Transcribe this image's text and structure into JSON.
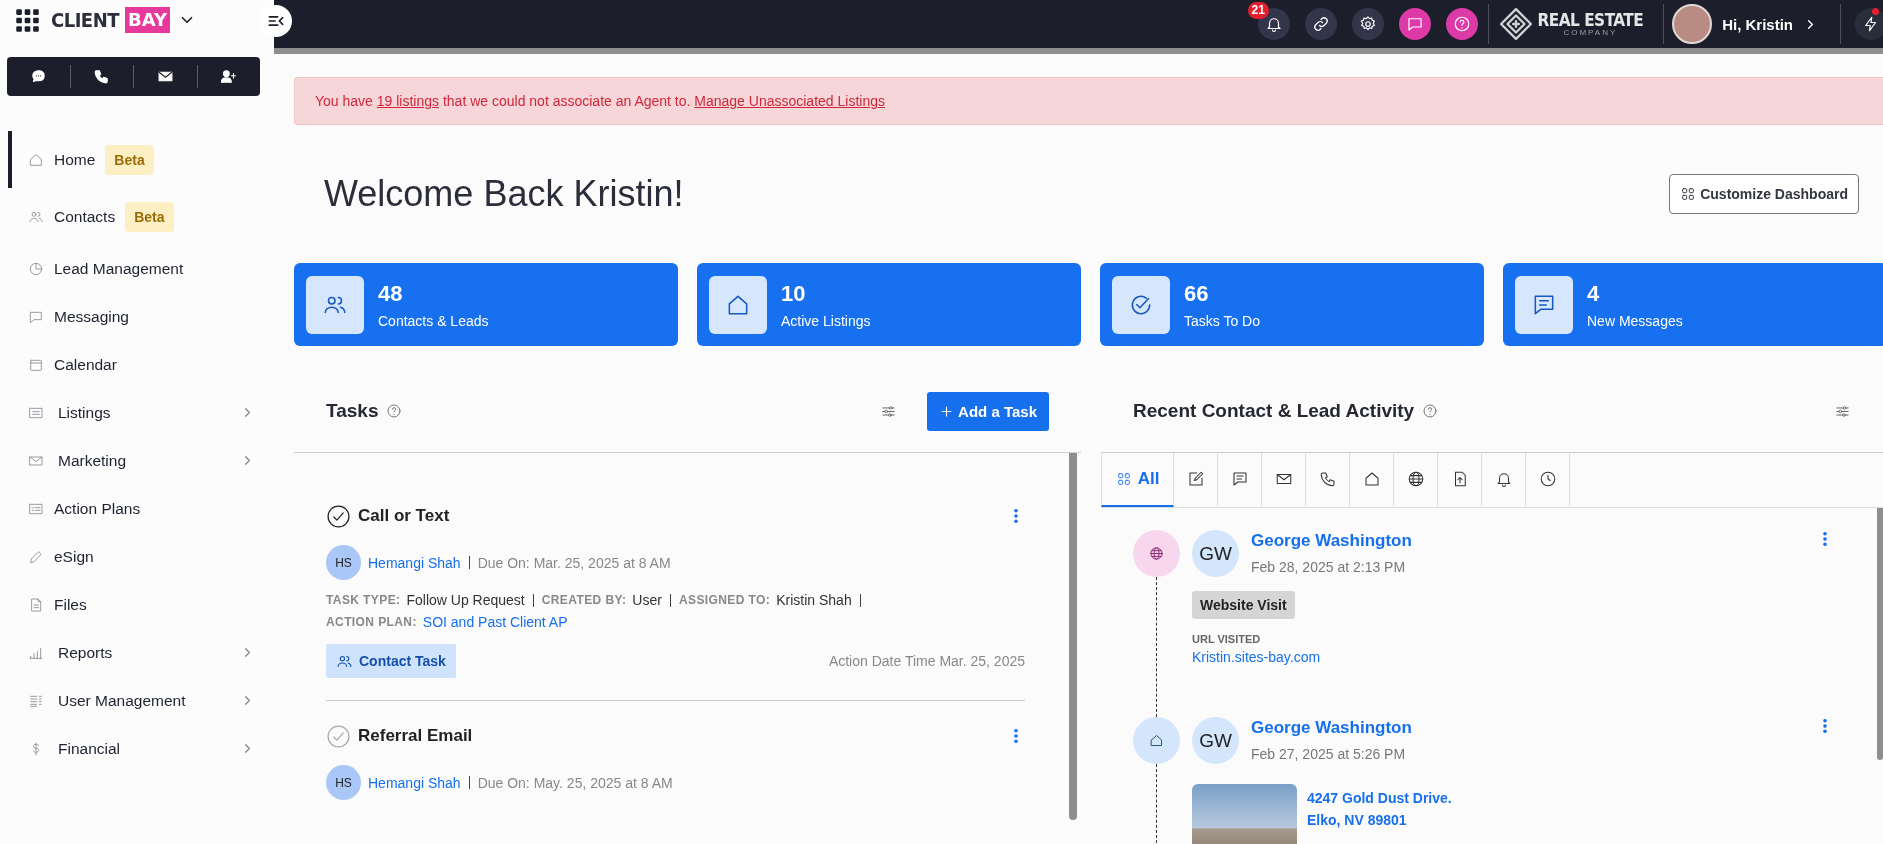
{
  "brand": {
    "logo_word": "CLIENT",
    "logo_tag": "BAY"
  },
  "topbar": {
    "notification_count": "21",
    "company": {
      "name": "REAL ESTATE",
      "tagline": "COMPANY"
    },
    "greeting": "Hi, Kristin"
  },
  "nav": [
    {
      "label": "Home",
      "badge": "Beta",
      "selected": true,
      "submenu": false
    },
    {
      "label": "Contacts",
      "badge": "Beta",
      "selected": false,
      "submenu": false
    },
    {
      "label": "Lead Management",
      "selected": false,
      "submenu": false
    },
    {
      "label": "Messaging",
      "selected": false,
      "submenu": false
    },
    {
      "label": "Calendar",
      "selected": false,
      "submenu": false
    },
    {
      "label": "Listings",
      "selected": false,
      "submenu": true
    },
    {
      "label": "Marketing",
      "selected": false,
      "submenu": true
    },
    {
      "label": "Action Plans",
      "selected": false,
      "submenu": false
    },
    {
      "label": "eSign",
      "selected": false,
      "submenu": false
    },
    {
      "label": "Files",
      "selected": false,
      "submenu": false
    },
    {
      "label": "Reports",
      "selected": false,
      "submenu": true
    },
    {
      "label": "User Management",
      "selected": false,
      "submenu": true
    },
    {
      "label": "Financial",
      "selected": false,
      "submenu": true
    }
  ],
  "alert": {
    "before": "You have ",
    "count_link": "19 listings",
    "middle": " that we could not associate an Agent to. ",
    "action_link": "Manage Unassociated Listings"
  },
  "welcome": {
    "title": "Welcome Back Kristin!",
    "customize_button": "Customize Dashboard"
  },
  "stats": [
    {
      "value": "48",
      "label": "Contacts & Leads"
    },
    {
      "value": "10",
      "label": "Active Listings"
    },
    {
      "value": "66",
      "label": "Tasks To Do"
    },
    {
      "value": "4",
      "label": "New Messages"
    }
  ],
  "tasks": {
    "title": "Tasks",
    "add_button": "Add a Task",
    "items": [
      {
        "title": "Call or Text",
        "emphasized": true,
        "initials": "HS",
        "assignee": "Hemangi Shah",
        "due": "Due On: Mar. 25, 2025 at 8 AM",
        "details": [
          {
            "label": "TASK TYPE:",
            "value": "Follow Up Request",
            "kind": "text"
          },
          {
            "label": "CREATED BY:",
            "value": "User",
            "kind": "text"
          },
          {
            "label": "ASSIGNED TO:",
            "value": "Kristin Shah",
            "kind": "text"
          },
          {
            "label": "ACTION PLAN:",
            "value": "SOI and Past Client AP",
            "kind": "link"
          }
        ],
        "tag": "Contact Task",
        "action_date": "Action Date Time Mar. 25, 2025"
      },
      {
        "title": "Referral Email",
        "emphasized": false,
        "initials": "HS",
        "assignee": "Hemangi Shah",
        "due": "Due On: May. 25, 2025 at 8 AM"
      }
    ]
  },
  "activity": {
    "title": "Recent Contact & Lead Activity",
    "tabs": [
      {
        "label": "All",
        "selected": true
      },
      {
        "selected": false
      },
      {
        "selected": false
      },
      {
        "selected": false
      },
      {
        "selected": false
      },
      {
        "selected": false
      },
      {
        "selected": false
      },
      {
        "selected": false
      },
      {
        "selected": false
      },
      {
        "selected": false
      }
    ],
    "events": [
      {
        "kind": "website",
        "initials": "GW",
        "name": "George Washington",
        "time": "Feb 28, 2025 at 2:13 PM",
        "tag": "Website Visit",
        "field_label": "URL VISITED",
        "url": "Kristin.sites-bay.com"
      },
      {
        "kind": "listing",
        "initials": "GW",
        "name": "George Washington",
        "time": "Feb 27, 2025 at 5:26 PM",
        "address": [
          "4247 Gold Dust Drive.",
          "Elko, NV 89801"
        ]
      }
    ]
  }
}
